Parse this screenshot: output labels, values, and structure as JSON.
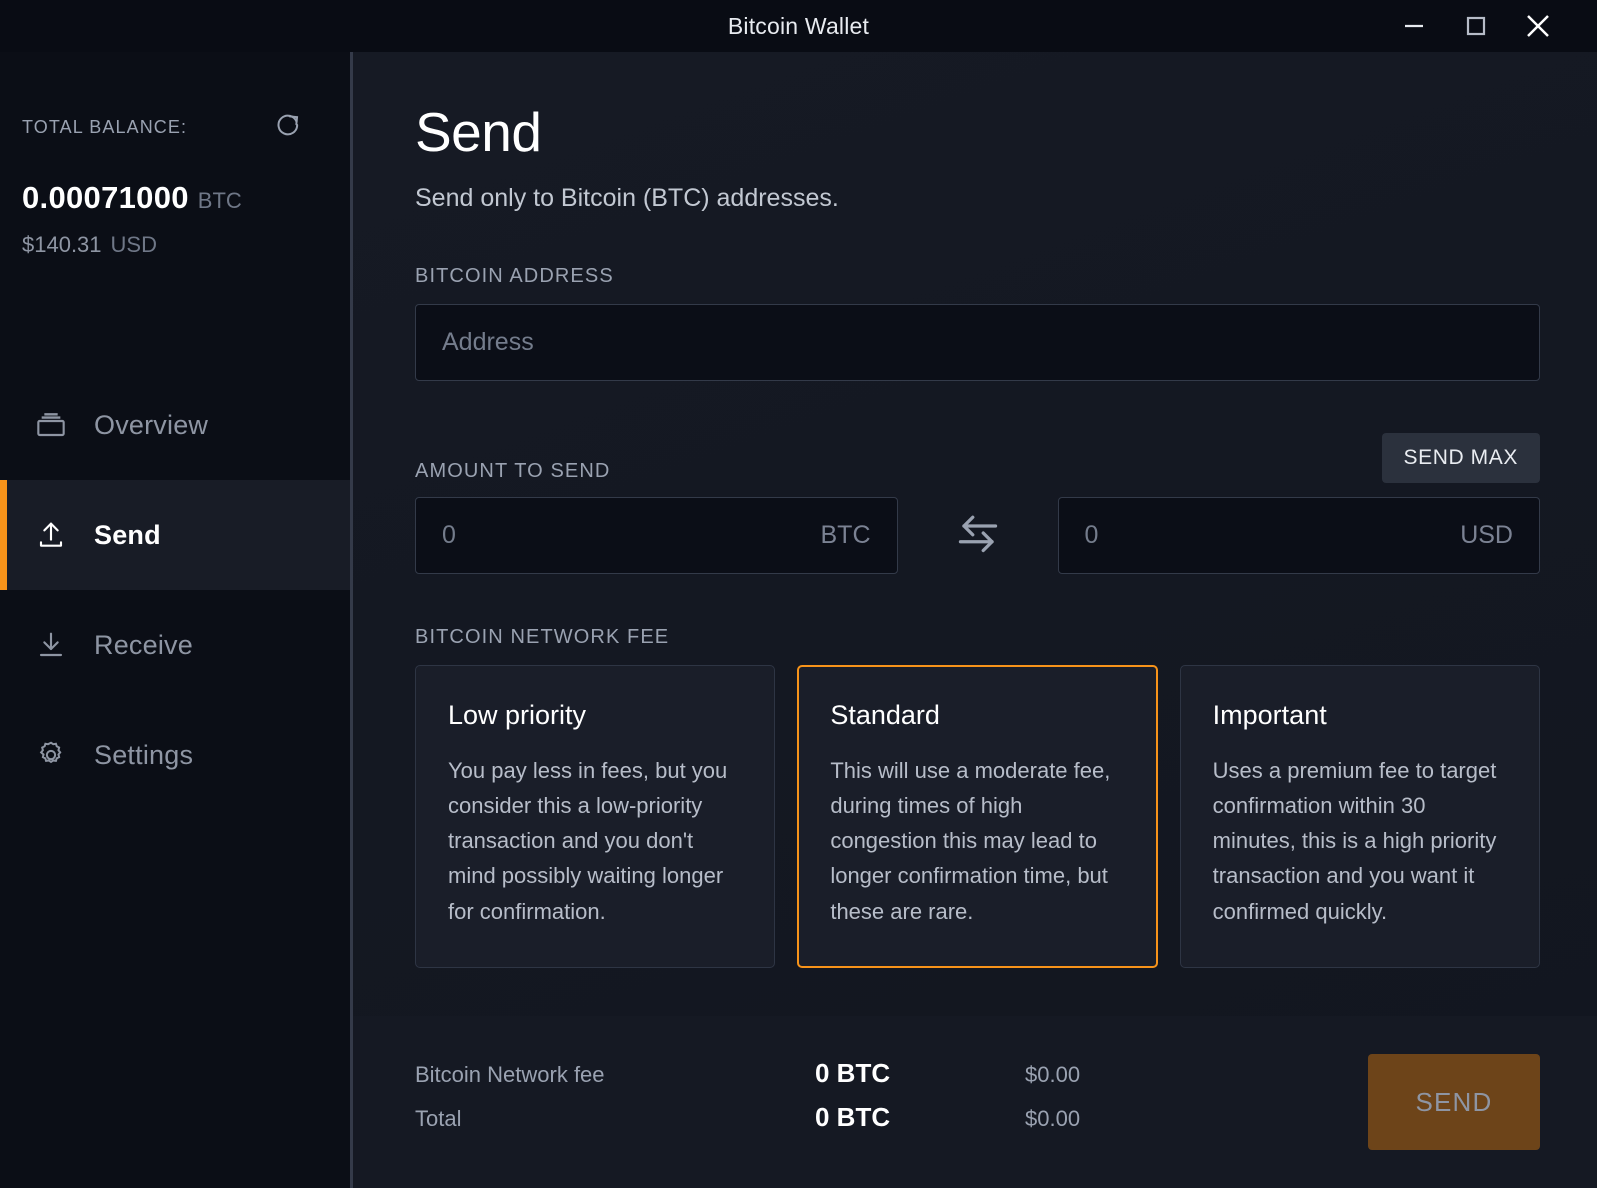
{
  "window": {
    "title": "Bitcoin Wallet",
    "controls": [
      {
        "name": "minimize",
        "icon": "minimize-icon"
      },
      {
        "name": "maximize",
        "icon": "maximize-icon"
      },
      {
        "name": "close",
        "icon": "close-icon"
      }
    ]
  },
  "sidebar": {
    "balance_label": "TOTAL BALANCE:",
    "refresh_icon": "refresh-icon",
    "balance_btc": "0.00071000",
    "balance_btc_unit": "BTC",
    "balance_usd": "$140.31",
    "balance_usd_unit": "USD",
    "items": [
      {
        "label": "Overview",
        "icon": "wallet-icon",
        "active": false
      },
      {
        "label": "Send",
        "icon": "upload-arrow-icon",
        "active": true
      },
      {
        "label": "Receive",
        "icon": "download-arrow-icon",
        "active": false
      },
      {
        "label": "Settings",
        "icon": "gear-icon",
        "active": false
      }
    ]
  },
  "main": {
    "title": "Send",
    "subtitle": "Send only to Bitcoin (BTC) addresses.",
    "address": {
      "label": "BITCOIN ADDRESS",
      "placeholder": "Address",
      "value": ""
    },
    "amount": {
      "label": "AMOUNT TO SEND",
      "send_max_label": "SEND MAX",
      "btc_placeholder": "0",
      "btc_unit": "BTC",
      "btc_value": "",
      "usd_placeholder": "0",
      "usd_unit": "USD",
      "usd_value": "",
      "swap_icon": "swap-arrows-icon"
    },
    "fee": {
      "label": "BITCOIN NETWORK FEE",
      "options": [
        {
          "title": "Low priority",
          "description": "You pay less in fees, but you consider this a low-priority transaction and you don't mind possibly waiting longer for confirmation.",
          "selected": false
        },
        {
          "title": "Standard",
          "description": "This will use a moderate fee, during times of high congestion this may lead to longer confirmation time, but these are rare.",
          "selected": true
        },
        {
          "title": "Important",
          "description": "Uses a premium fee to target confirmation within 30 minutes, this is a high priority transaction and you want it confirmed quickly.",
          "selected": false
        }
      ]
    }
  },
  "footer": {
    "rows": [
      {
        "label": "Bitcoin Network fee",
        "btc": "0 BTC",
        "usd": "$0.00"
      },
      {
        "label": "Total",
        "btc": "0 BTC",
        "usd": "$0.00"
      }
    ],
    "send_label": "SEND"
  },
  "colors": {
    "accent": "#f7931a",
    "send_button_bg": "#6d4419",
    "window_bg": "#0b0e16",
    "panel_bg": "#1a1e29"
  }
}
